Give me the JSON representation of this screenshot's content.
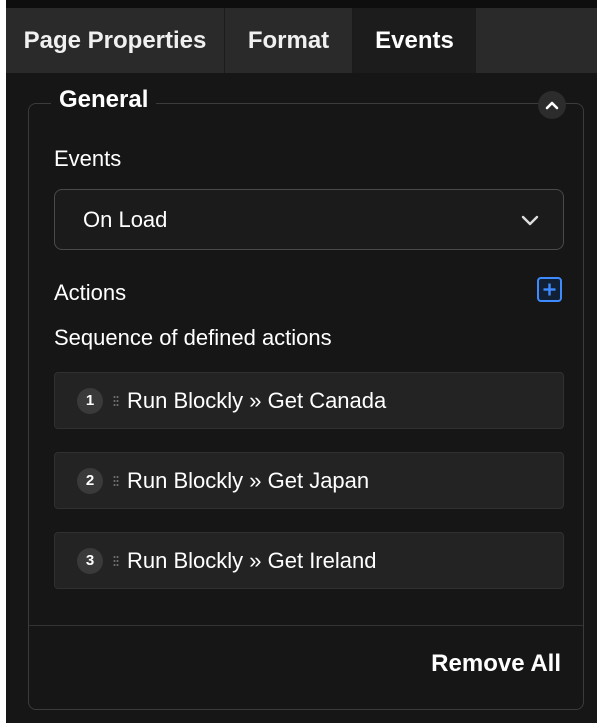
{
  "tabs": [
    {
      "label": "Page Properties"
    },
    {
      "label": "Format"
    },
    {
      "label": "Events"
    }
  ],
  "panel": {
    "title": "General",
    "events_label": "Events",
    "events_select": {
      "selected": "On Load"
    },
    "actions_label": "Actions",
    "sequence_label": "Sequence of defined actions",
    "actions": [
      {
        "number": "1",
        "text": "Run Blockly » Get Canada"
      },
      {
        "number": "2",
        "text": "Run Blockly » Get Japan"
      },
      {
        "number": "3",
        "text": "Run Blockly » Get Ireland"
      }
    ],
    "remove_all_label": "Remove All"
  },
  "colors": {
    "background": "#161616",
    "tabbar": "#2a2a2a",
    "active_tab": "#1c1c1c",
    "accent": "#3d8bff"
  },
  "icons": {
    "collapse": "chevron-up-icon",
    "select": "chevron-down-icon",
    "add": "plus-icon",
    "drag": "drag-handle-icon"
  }
}
